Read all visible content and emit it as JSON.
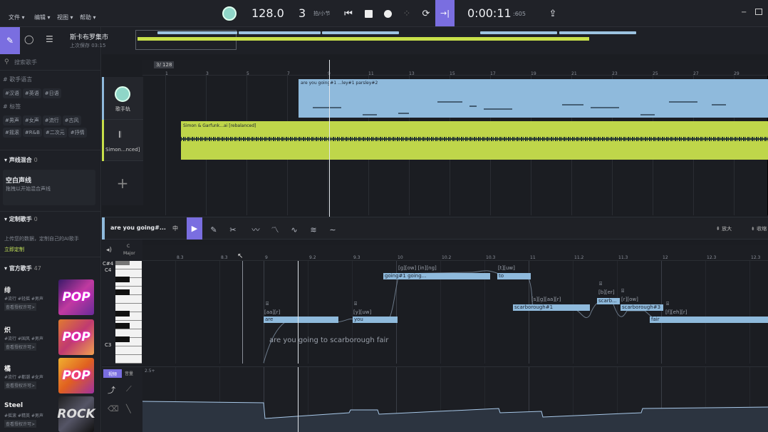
{
  "menu": [
    "文件 ▾",
    "编辑 ▾",
    "视图 ▾",
    "帮助 ▾"
  ],
  "transport": {
    "tempo": "128.0",
    "beats": "3",
    "beats_unit": "拍/小节",
    "time": "0:00:11",
    "time_ms": ":605"
  },
  "project": {
    "name": "斯卡布罗集市",
    "saved": "上次保存 03:15"
  },
  "search": {
    "placeholder": "搜索歌手"
  },
  "filters": {
    "lang_title": "# 歌手语言",
    "langs": [
      "#汉语",
      "#英语",
      "#日语"
    ],
    "tag_title": "# 标签",
    "tags": [
      "#男声",
      "#女声",
      "#流行",
      "#古风",
      "#摇滚",
      "#R&B",
      "#二次元",
      "#抒情"
    ]
  },
  "sections": {
    "mix": "声线混合",
    "mix_count": "0",
    "blank_title": "空白声线",
    "blank_sub": "拖拽以开始混合声线",
    "custom": "定制歌手",
    "custom_count": "0",
    "custom_desc": "上传您的数据，定制自己的AI歌手",
    "custom_link": "立即定制",
    "official": "官方歌手",
    "official_count": "47"
  },
  "singers": [
    {
      "name": "绯",
      "tags": "#流行 #轻摇 #男声",
      "sub": "查看授权许可>",
      "cover": "POP"
    },
    {
      "name": "炽",
      "tags": "#流行 #国风 #男声",
      "sub": "查看授权许可>",
      "cover": "POP"
    },
    {
      "name": "橘",
      "tags": "#流行 #都潮 #女声",
      "sub": "查看授权许可>",
      "cover": "POP"
    },
    {
      "name": "Steel",
      "tags": "#摇滚 #精英 #男声",
      "sub": "查看授权许可>",
      "cover": "ROCK"
    }
  ],
  "timeline": {
    "sig": "3/",
    "tempo": "128",
    "bars": [
      "1",
      "3",
      "5",
      "7",
      "9",
      "11",
      "13",
      "15",
      "17",
      "19",
      "21",
      "23",
      "25",
      "27",
      "29"
    ]
  },
  "tracks": [
    {
      "label": "歌手轨",
      "clip": "are you going#1 ...ley#1 parsley#2"
    },
    {
      "label": "Simon...nced]",
      "clip": "Simon & Garfunk...ai [rebalanced]"
    }
  ],
  "editor": {
    "clip_name": "are you going#...",
    "lang": "中",
    "zoom_in": "放大",
    "zoom_out": "收缩",
    "key_top": "C",
    "key_bottom": "Major",
    "key_c4s": "C#4",
    "key_c4": "C4",
    "key_c3": "C3",
    "ruler": [
      "8.3",
      "8.3",
      "9",
      "9.2",
      "9.3",
      "10",
      "10.2",
      "10.3",
      "11",
      "11.2",
      "11.3",
      "12",
      "12.3",
      "12.3"
    ],
    "notes": [
      {
        "phon": "[aa][r]",
        "text": "are"
      },
      {
        "phon": "[y][uw]",
        "text": "you"
      },
      {
        "phon": "[g][ow] [in][ng]",
        "text": "going#1 going..."
      },
      {
        "phon": "[t][uw]",
        "text": "to"
      },
      {
        "phon": "[s][g][aa][r]",
        "text": "scarborough#1"
      },
      {
        "phon": "[b][er]",
        "text": "scarb..."
      },
      {
        "phon": "[r][ow]",
        "text": "scarborough#3"
      },
      {
        "phon": "[f][eh][r]",
        "text": "fair"
      }
    ],
    "lyric_overlay": "are you going to scarborough fair",
    "param_tab1": "视频",
    "param_tab2": "音量",
    "param_scale": "2.5+"
  }
}
